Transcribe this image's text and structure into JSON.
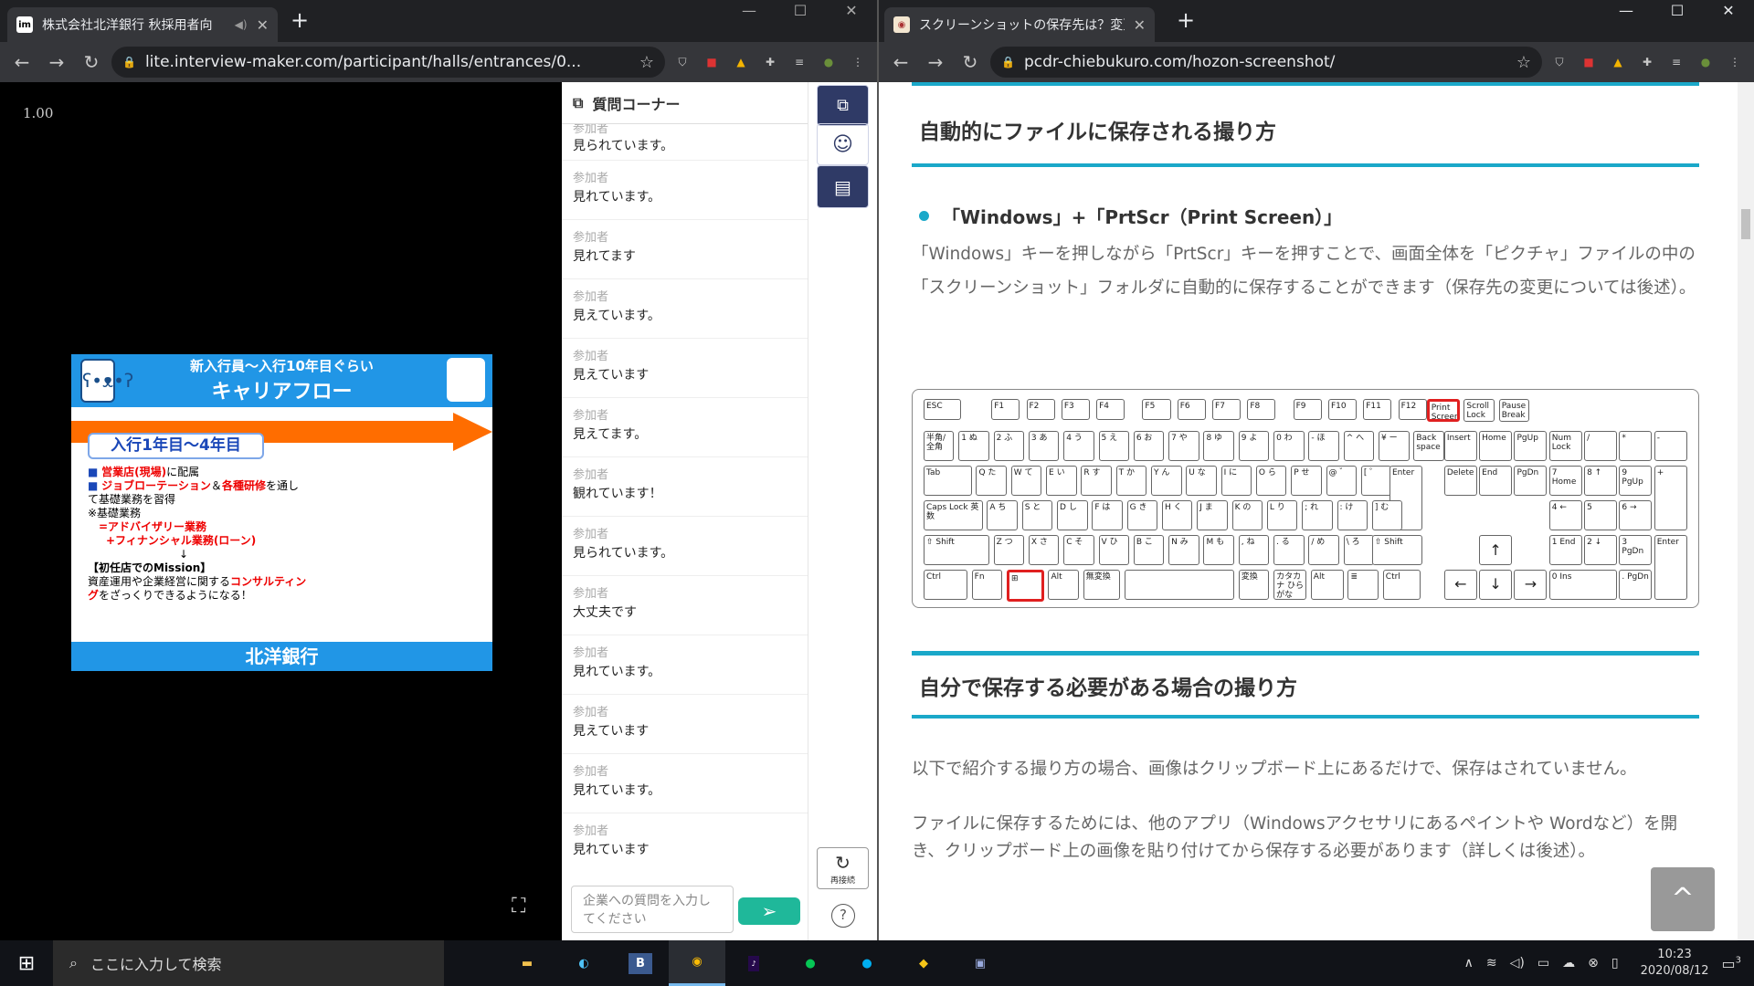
{
  "left_window": {
    "tab_title": "株式会社北洋銀行 秋採用者向",
    "tab_favicon": "im",
    "url": "lite.interview-maker.com/participant/halls/entrances/0...",
    "playback_speed": "1.00",
    "slide": {
      "header_line1": "新入行員～入行10年目ぐらい",
      "header_line2": "キャリアフロー",
      "year_box": "入行1年目～4年目",
      "bullet1_red": "営業店(現場)",
      "bullet1_rest": "に配属",
      "bullet2_red_a": "ジョブローテーション",
      "bullet2_mid": "＆",
      "bullet2_red_b": "各種研修",
      "bullet2_rest": "を通して基礎業務を習得",
      "note_label": "※基礎業務",
      "advisory": "=アドバイザリー業務",
      "financial": "+フィナンシャル業務(ローン)",
      "down_arrow": "↓",
      "mission": "【初任店でのMission】",
      "mission_text_a": "資産運用や企業経営に関する",
      "mission_text_red": "コンサルティング",
      "mission_text_b": "をざっくりできるようになる！",
      "footer": "北洋銀行"
    },
    "chat": {
      "header": "質問コーナー",
      "top_partial_label": "参加者",
      "top_partial_text": "見られています。",
      "messages": [
        {
          "who": "参加者",
          "text": "見れています。"
        },
        {
          "who": "参加者",
          "text": "見れてます"
        },
        {
          "who": "参加者",
          "text": "見えています。"
        },
        {
          "who": "参加者",
          "text": "見えています"
        },
        {
          "who": "参加者",
          "text": "見えてます。"
        },
        {
          "who": "参加者",
          "text": "観れています！"
        },
        {
          "who": "参加者",
          "text": "見られています。"
        },
        {
          "who": "参加者",
          "text": "大丈夫です"
        },
        {
          "who": "参加者",
          "text": "見れています。"
        },
        {
          "who": "参加者",
          "text": "見えています"
        },
        {
          "who": "参加者",
          "text": "見れています。"
        },
        {
          "who": "参加者",
          "text": "見れています"
        }
      ],
      "input_placeholder": "企業への質問を入力してください",
      "reconnect_label": "再接続",
      "help_label": "?"
    }
  },
  "right_window": {
    "tab_title": "スクリーンショットの保存先は？変更方",
    "url": "pcdr-chiebukuro.com/hozon-screenshot/",
    "heading1": "自動的にファイルに保存される撮り方",
    "bullet": "「Windows」+「PrtScr（Print Screen）」",
    "para1": "「Windows」キーを押しながら「PrtScr」キーを押すことで、画面全体を「ピクチャ」ファイルの中の「スクリーンショット」フォルダに自動的に保存することができます（保存先の変更については後述）。",
    "heading2": "自分で保存する必要がある場合の撮り方",
    "para2a": "以下で紹介する撮り方の場合、画像はクリップボード上にあるだけで、保存はされていません。",
    "para2b": "ファイルに保存するためには、他のアプリ（Windowsアクセサリにあるペイントや Wordなど）を開き、クリップボード上の画像を貼り付けてから保存する必要があります（詳しくは後述）。",
    "up_button": "^"
  },
  "taskbar": {
    "search_placeholder": "ここに入力して検索",
    "time": "10:23",
    "date": "2020/08/12",
    "notifications": "3"
  },
  "colors": {
    "accent_teal": "#1aa8c9",
    "slide_blue": "#2196e6",
    "slide_orange": "#ff6d00",
    "send_green": "#1fb89a"
  }
}
